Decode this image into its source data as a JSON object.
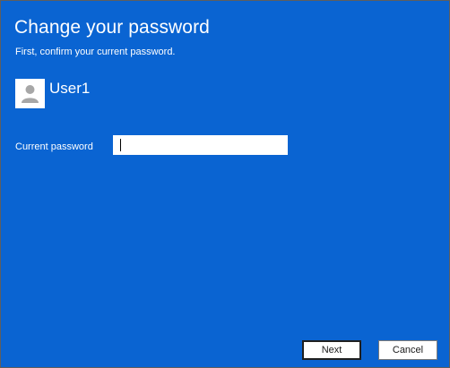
{
  "dialog": {
    "title": "Change your password",
    "subtitle": "First, confirm your current password.",
    "username": "User1",
    "avatar_icon": "user-icon",
    "field": {
      "label": "Current password",
      "value": "",
      "placeholder": ""
    },
    "buttons": {
      "next_label": "Next",
      "cancel_label": "Cancel"
    }
  },
  "colors": {
    "background": "#0a64d2",
    "text": "#ffffff"
  }
}
